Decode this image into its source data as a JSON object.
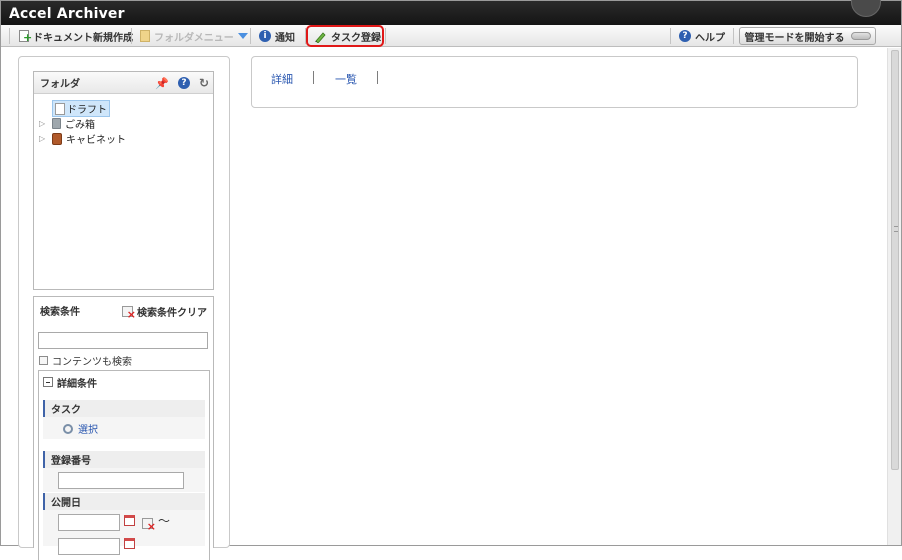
{
  "app": {
    "title": "Accel Archiver"
  },
  "toolbar": {
    "new_document": "ドキュメント新規作成",
    "folder_menu": "フォルダメニュー",
    "notice": "通知",
    "task_register": "タスク登録",
    "help": "ヘルプ",
    "admin_mode": "管理モードを開始する"
  },
  "folder_panel": {
    "title": "フォルダ",
    "items": [
      {
        "label": "ドラフト",
        "icon": "draft-icon",
        "selected": true,
        "expandable": false
      },
      {
        "label": "ごみ箱",
        "icon": "trash-icon",
        "selected": false,
        "expandable": true
      },
      {
        "label": "キャビネット",
        "icon": "cabinet-icon",
        "selected": false,
        "expandable": true
      }
    ]
  },
  "search_panel": {
    "title": "検索条件",
    "clear_label": "検索条件クリア",
    "keyword_value": "",
    "content_search_label": "コンテンツも検索",
    "detail_title": "詳細条件",
    "task_section": "タスク",
    "task_select_link": "選択",
    "reg_no_section": "登録番号",
    "reg_no_value": "",
    "pub_date_section": "公開日",
    "range_sep": "〜"
  },
  "main": {
    "tabs": [
      "詳細",
      "一覧"
    ]
  },
  "colors": {
    "titlebar": "#1c1c1c",
    "highlight": "#e01818",
    "link": "#2a57b0",
    "section_accent": "#3f63a8"
  }
}
